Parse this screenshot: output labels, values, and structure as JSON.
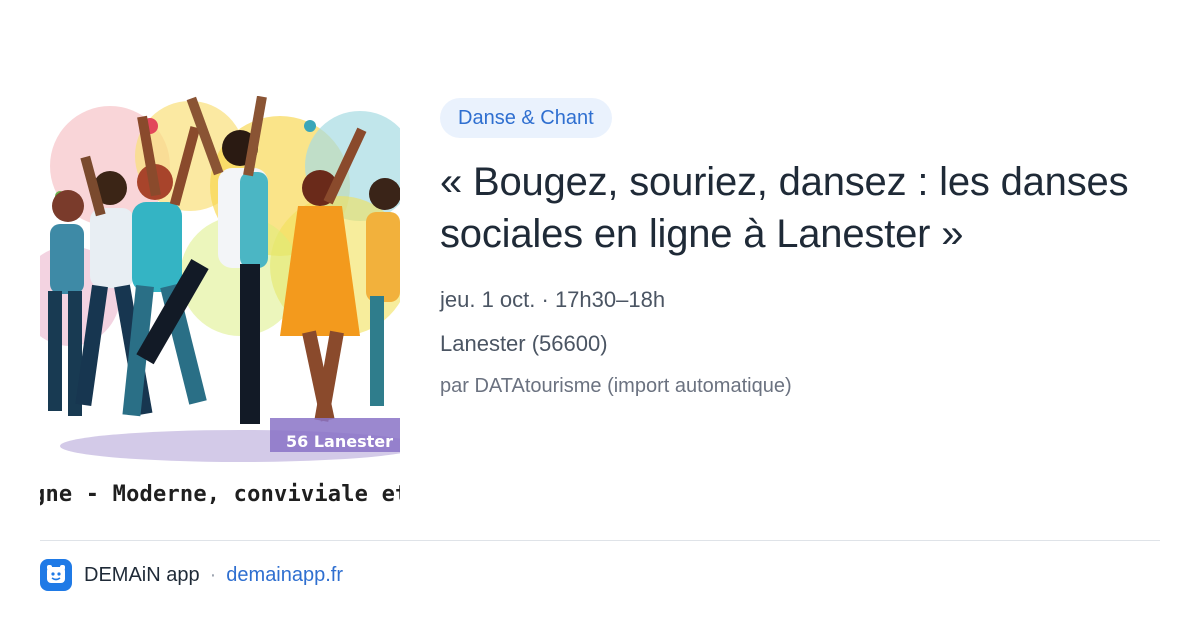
{
  "card": {
    "image": {
      "overlay_label": "56 Lanester",
      "caption": "gne - Moderne, conviviale et"
    },
    "category": "Danse & Chant",
    "title": "« Bougez, souriez, dansez : les danses sociales en ligne à Lanester »",
    "date": "jeu. 1 oct. · 17h30–18h",
    "location": "Lanester (56600)",
    "source": "par DATAtourisme (import automatique)"
  },
  "footer": {
    "app_icon": "demain-app-logo-icon",
    "app_name": "DEMAiN app",
    "separator": "·",
    "domain": "demainapp.fr"
  },
  "colors": {
    "chip_bg": "#eaf2fd",
    "accent": "#2f6fd0",
    "title": "#1f2a37",
    "muted": "#6b7280"
  }
}
